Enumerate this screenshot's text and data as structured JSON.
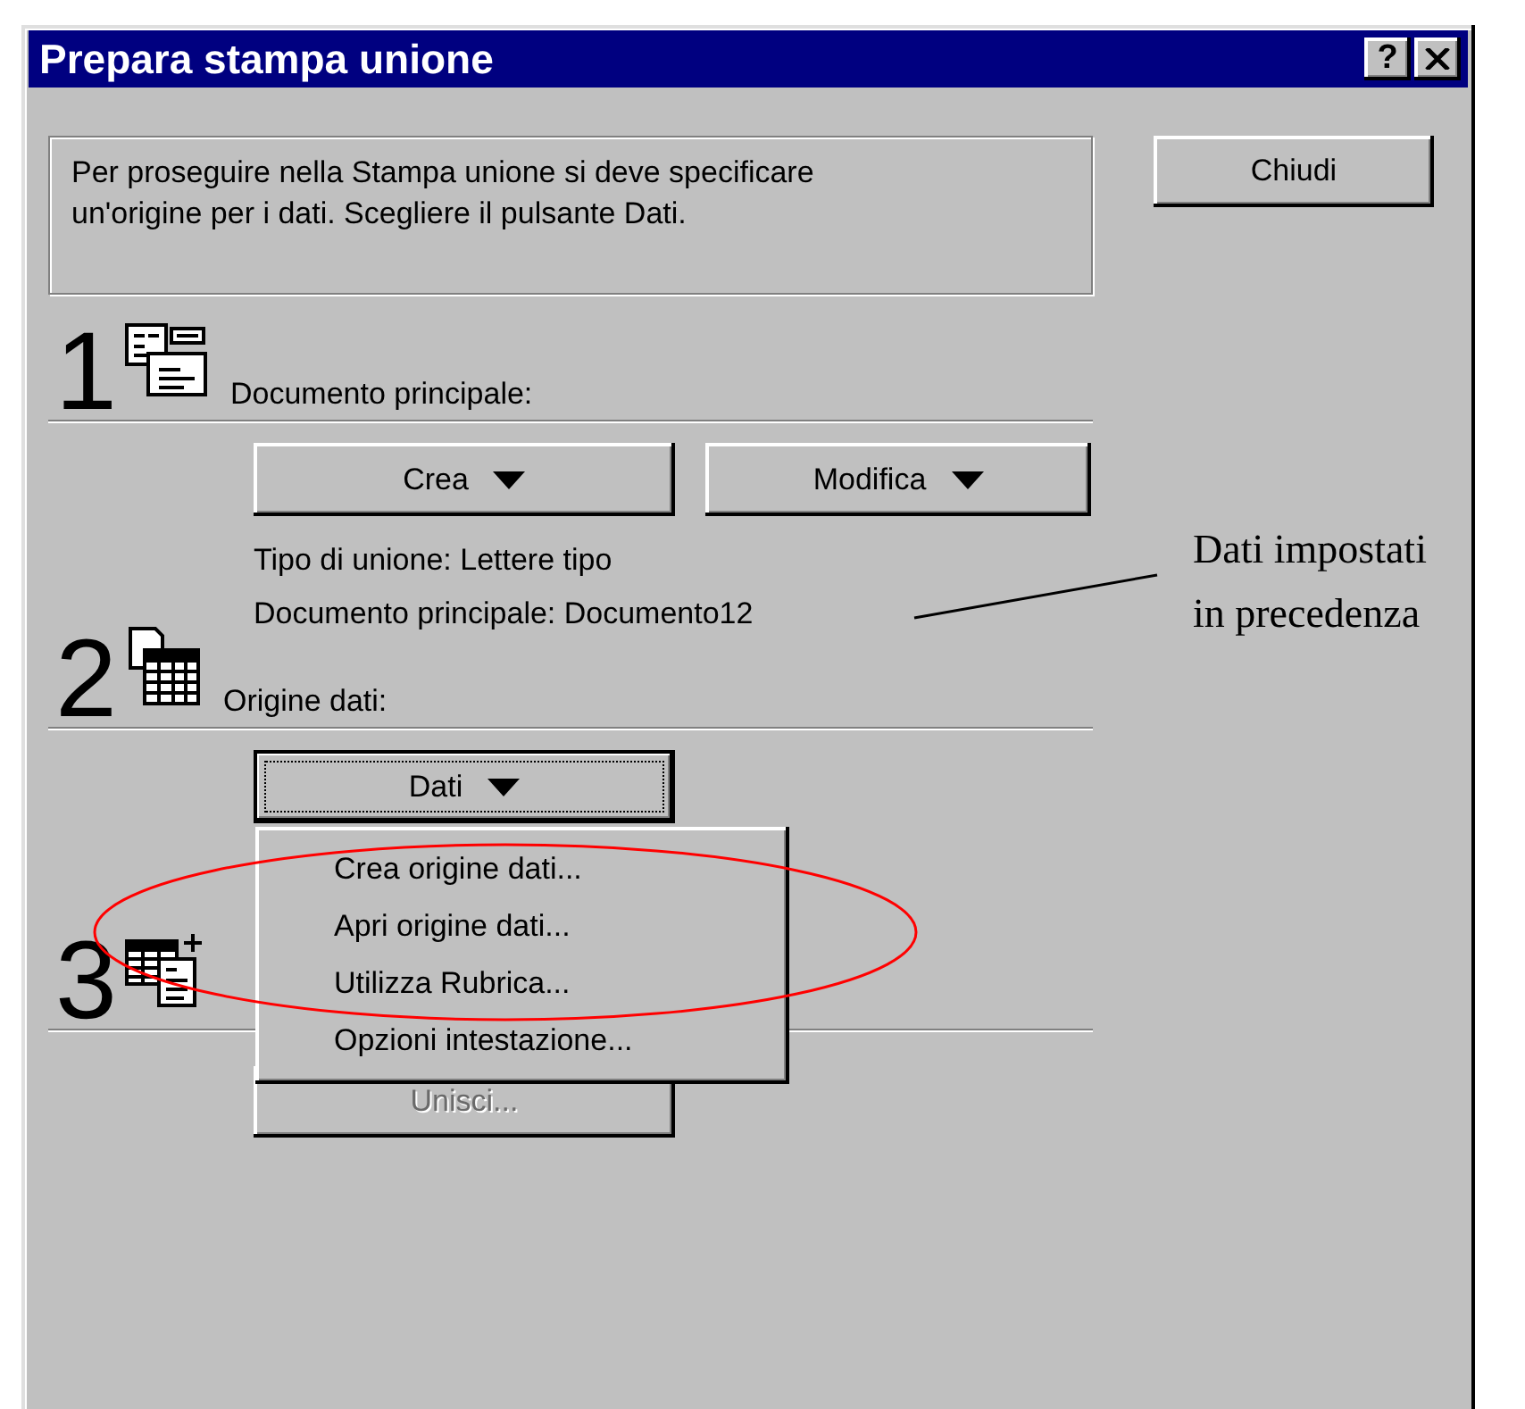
{
  "window": {
    "title": "Prepara stampa unione",
    "help_button": "?"
  },
  "message": "Per proseguire nella Stampa unione si deve specificare un'origine per i dati. Scegliere il pulsante Dati.",
  "close_button": "Chiudi",
  "steps": [
    {
      "number": "1",
      "kind": "document",
      "label": "Documento principale:",
      "buttons": [
        {
          "label": "Crea",
          "dropdown": true,
          "focused": false,
          "disabled": false
        },
        {
          "label": "Modifica",
          "dropdown": true,
          "focused": false,
          "disabled": false
        }
      ],
      "info": [
        "Tipo di unione: Lettere tipo",
        "Documento principale: Documento12"
      ]
    },
    {
      "number": "2",
      "kind": "table",
      "label": "Origine dati:",
      "buttons": [
        {
          "label": "Dati",
          "dropdown": true,
          "focused": true,
          "disabled": false
        }
      ]
    },
    {
      "number": "3",
      "kind": "merge",
      "buttons": [
        {
          "label": "Unisci...",
          "dropdown": false,
          "focused": false,
          "disabled": true
        }
      ]
    }
  ],
  "menu": {
    "items": [
      "Crea origine dati...",
      "Apri origine dati...",
      "Utilizza Rubrica...",
      "Opzioni intestazione..."
    ]
  },
  "annotation": {
    "lines": [
      "Dati impostati",
      "in precedenza"
    ]
  }
}
